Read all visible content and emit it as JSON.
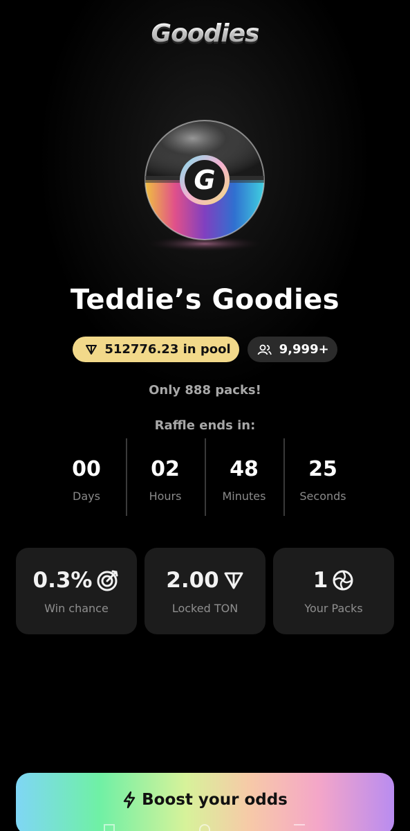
{
  "app": {
    "logo_text": "Goodies"
  },
  "hero": {
    "orb_letter": "G",
    "title": "Teddie’s Goodies"
  },
  "chips": {
    "pool_label": "512776.23 in pool",
    "participants_label": "9,999+"
  },
  "info": {
    "packs_note": "Only 888 packs!",
    "raffle_label": "Raffle ends in:"
  },
  "countdown": [
    {
      "value": "00",
      "unit": "Days"
    },
    {
      "value": "02",
      "unit": "Hours"
    },
    {
      "value": "48",
      "unit": "Minutes"
    },
    {
      "value": "25",
      "unit": "Seconds"
    }
  ],
  "stats": [
    {
      "value": "0.3%",
      "label": "Win chance",
      "icon": "target-icon"
    },
    {
      "value": "2.00",
      "label": "Locked TON",
      "icon": "ton-icon"
    },
    {
      "value": "1",
      "label": "Your Packs",
      "icon": "pack-icon"
    }
  ],
  "cta": {
    "label": "Boost your odds",
    "icon": "lightning-icon"
  },
  "colors": {
    "pool_chip": "#f2d98a",
    "card_bg": "#1c1c1c",
    "background": "#000000"
  }
}
